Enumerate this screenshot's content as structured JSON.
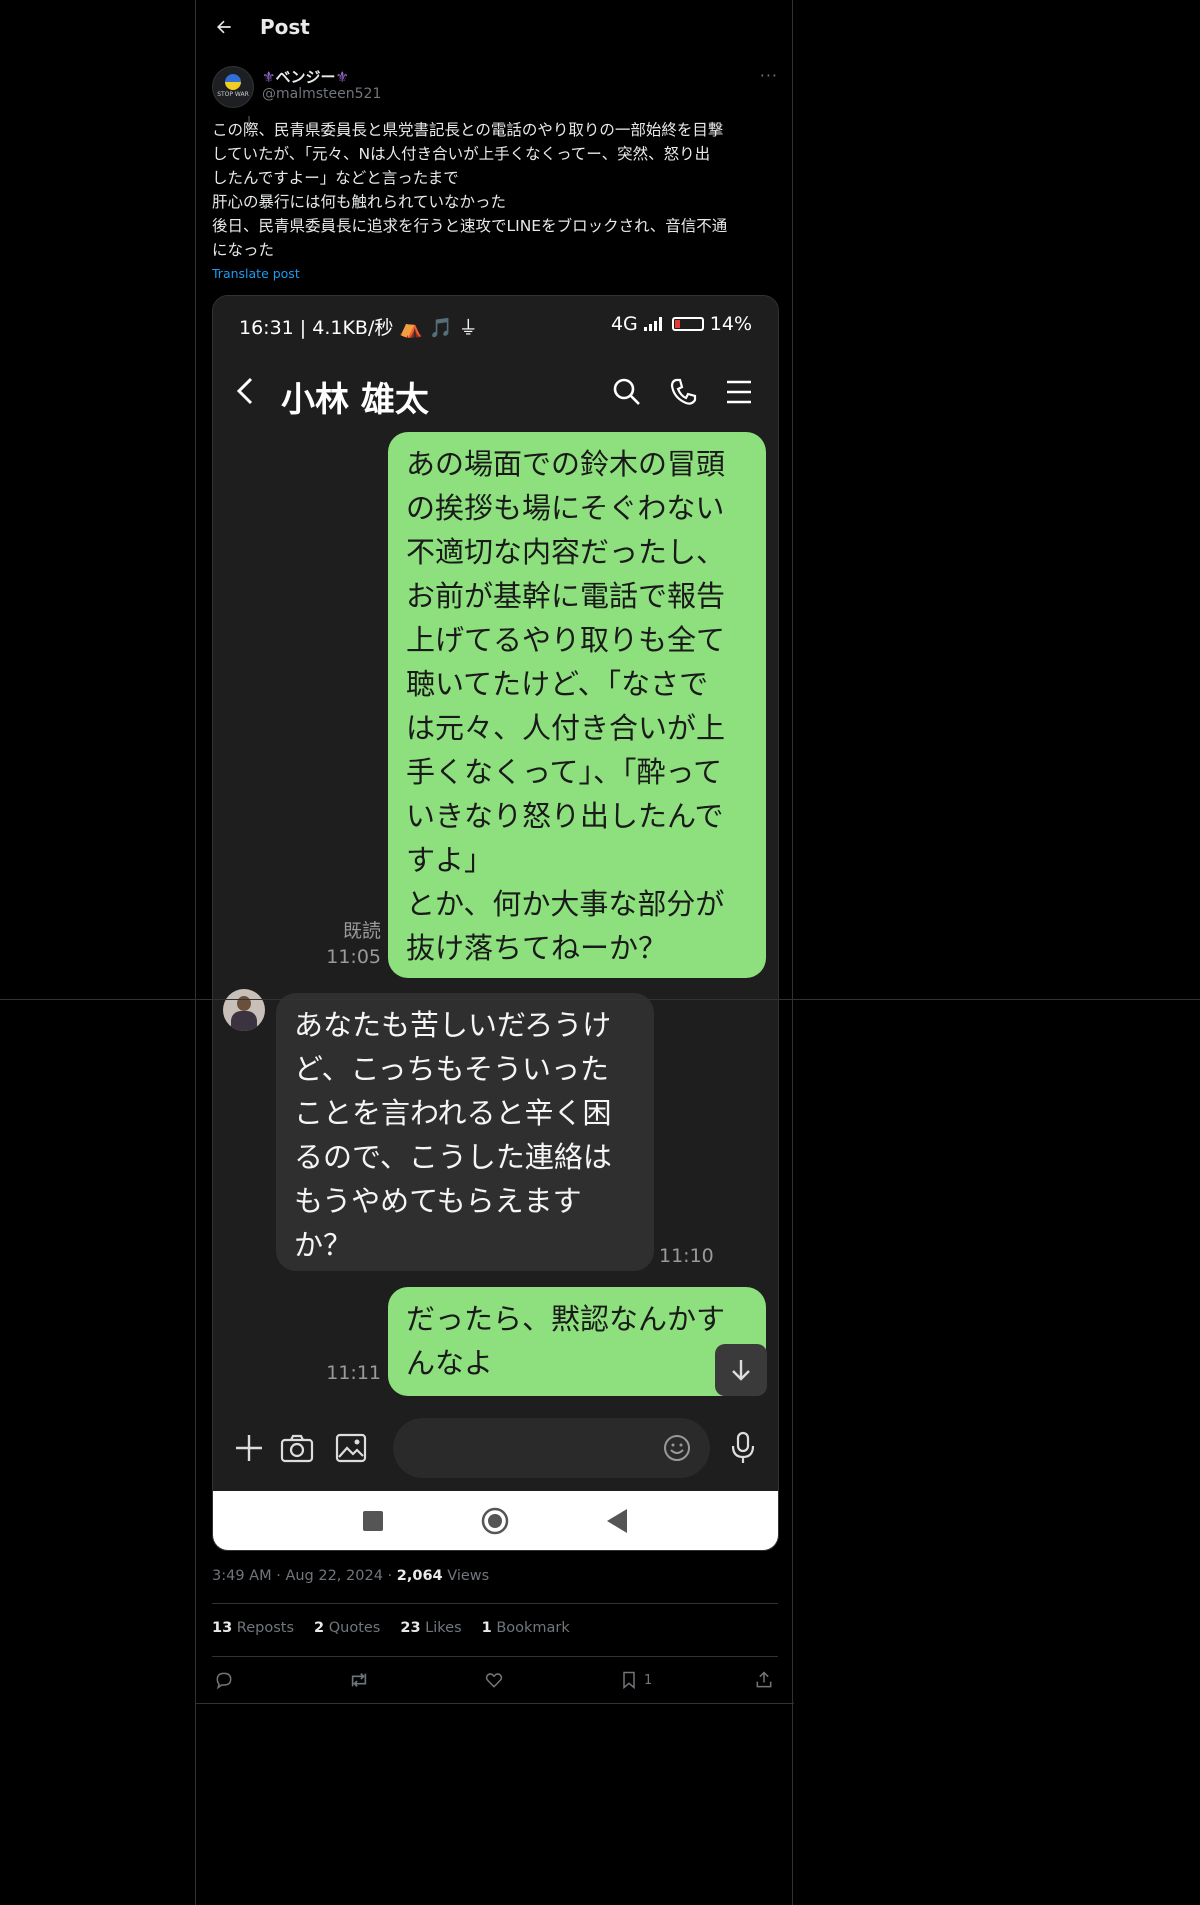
{
  "header": {
    "title": "Post"
  },
  "author": {
    "display_name": "ベンジー",
    "handle": "@malmsteen521",
    "avatar_text": "STOP WAR"
  },
  "post": {
    "text": "この際、民青県委員長と県党書記長との電話のやり取りの一部始終を目撃\nしていたが、「元々、Nは人付き合いが上手くなくってー、突然、怒り出\nしたんですよー」などと言ったまで\n肝心の暴行には何も触れられていなかった\n後日、民青県委員長に追求を行うと速攻でLINEをブロックされ、音信不通\nになった",
    "translate_label": "Translate post"
  },
  "screenshot": {
    "status_left": "16:31 | 4.1KB/秒 ⛺ 🎵 ⏚",
    "status_net": "4G",
    "status_battery": "14%",
    "chat_name": "小林 雄太",
    "messages": [
      {
        "direction": "out",
        "text": "あの場面での鈴木の冒頭\nの挨拶も場にそぐわない\n不適切な内容だったし、\nお前が基幹に電話で報告\n上げてるやり取りも全て\n聴いてたけど、「なさで\nは元々、人付き合いが上\n手くなくって」、「酔って\nいきなり怒り出したんで\nすよ」\nとか、何か大事な部分が\n抜け落ちてねーか？",
        "read": "既読",
        "time": "11:05"
      },
      {
        "direction": "in",
        "text": "あなたも苦しいだろうけ\nど、こっちもそういった\nことを言われると辛く困\nるので、こうした連絡は\nもうやめてもらえます\nか？",
        "time": "11:10"
      },
      {
        "direction": "out",
        "text": "だったら、黙認なんかす\nんなよ",
        "time": "11:11"
      }
    ],
    "input_placeholder": ""
  },
  "meta": {
    "time": "3:49 AM",
    "date": "Aug 22, 2024",
    "views_count": "2,064",
    "views_label": "Views"
  },
  "stats": {
    "reposts_count": "13",
    "reposts_label": "Reposts",
    "quotes_count": "2",
    "quotes_label": "Quotes",
    "likes_count": "23",
    "likes_label": "Likes",
    "bookmarks_count": "1",
    "bookmarks_label": "Bookmark"
  },
  "actions": {
    "bookmark_count": "1"
  },
  "colors": {
    "background": "#000000",
    "accent": "#1d9bf0",
    "line_green": "#8de07d",
    "bubble_dark": "#2f2f2f"
  }
}
